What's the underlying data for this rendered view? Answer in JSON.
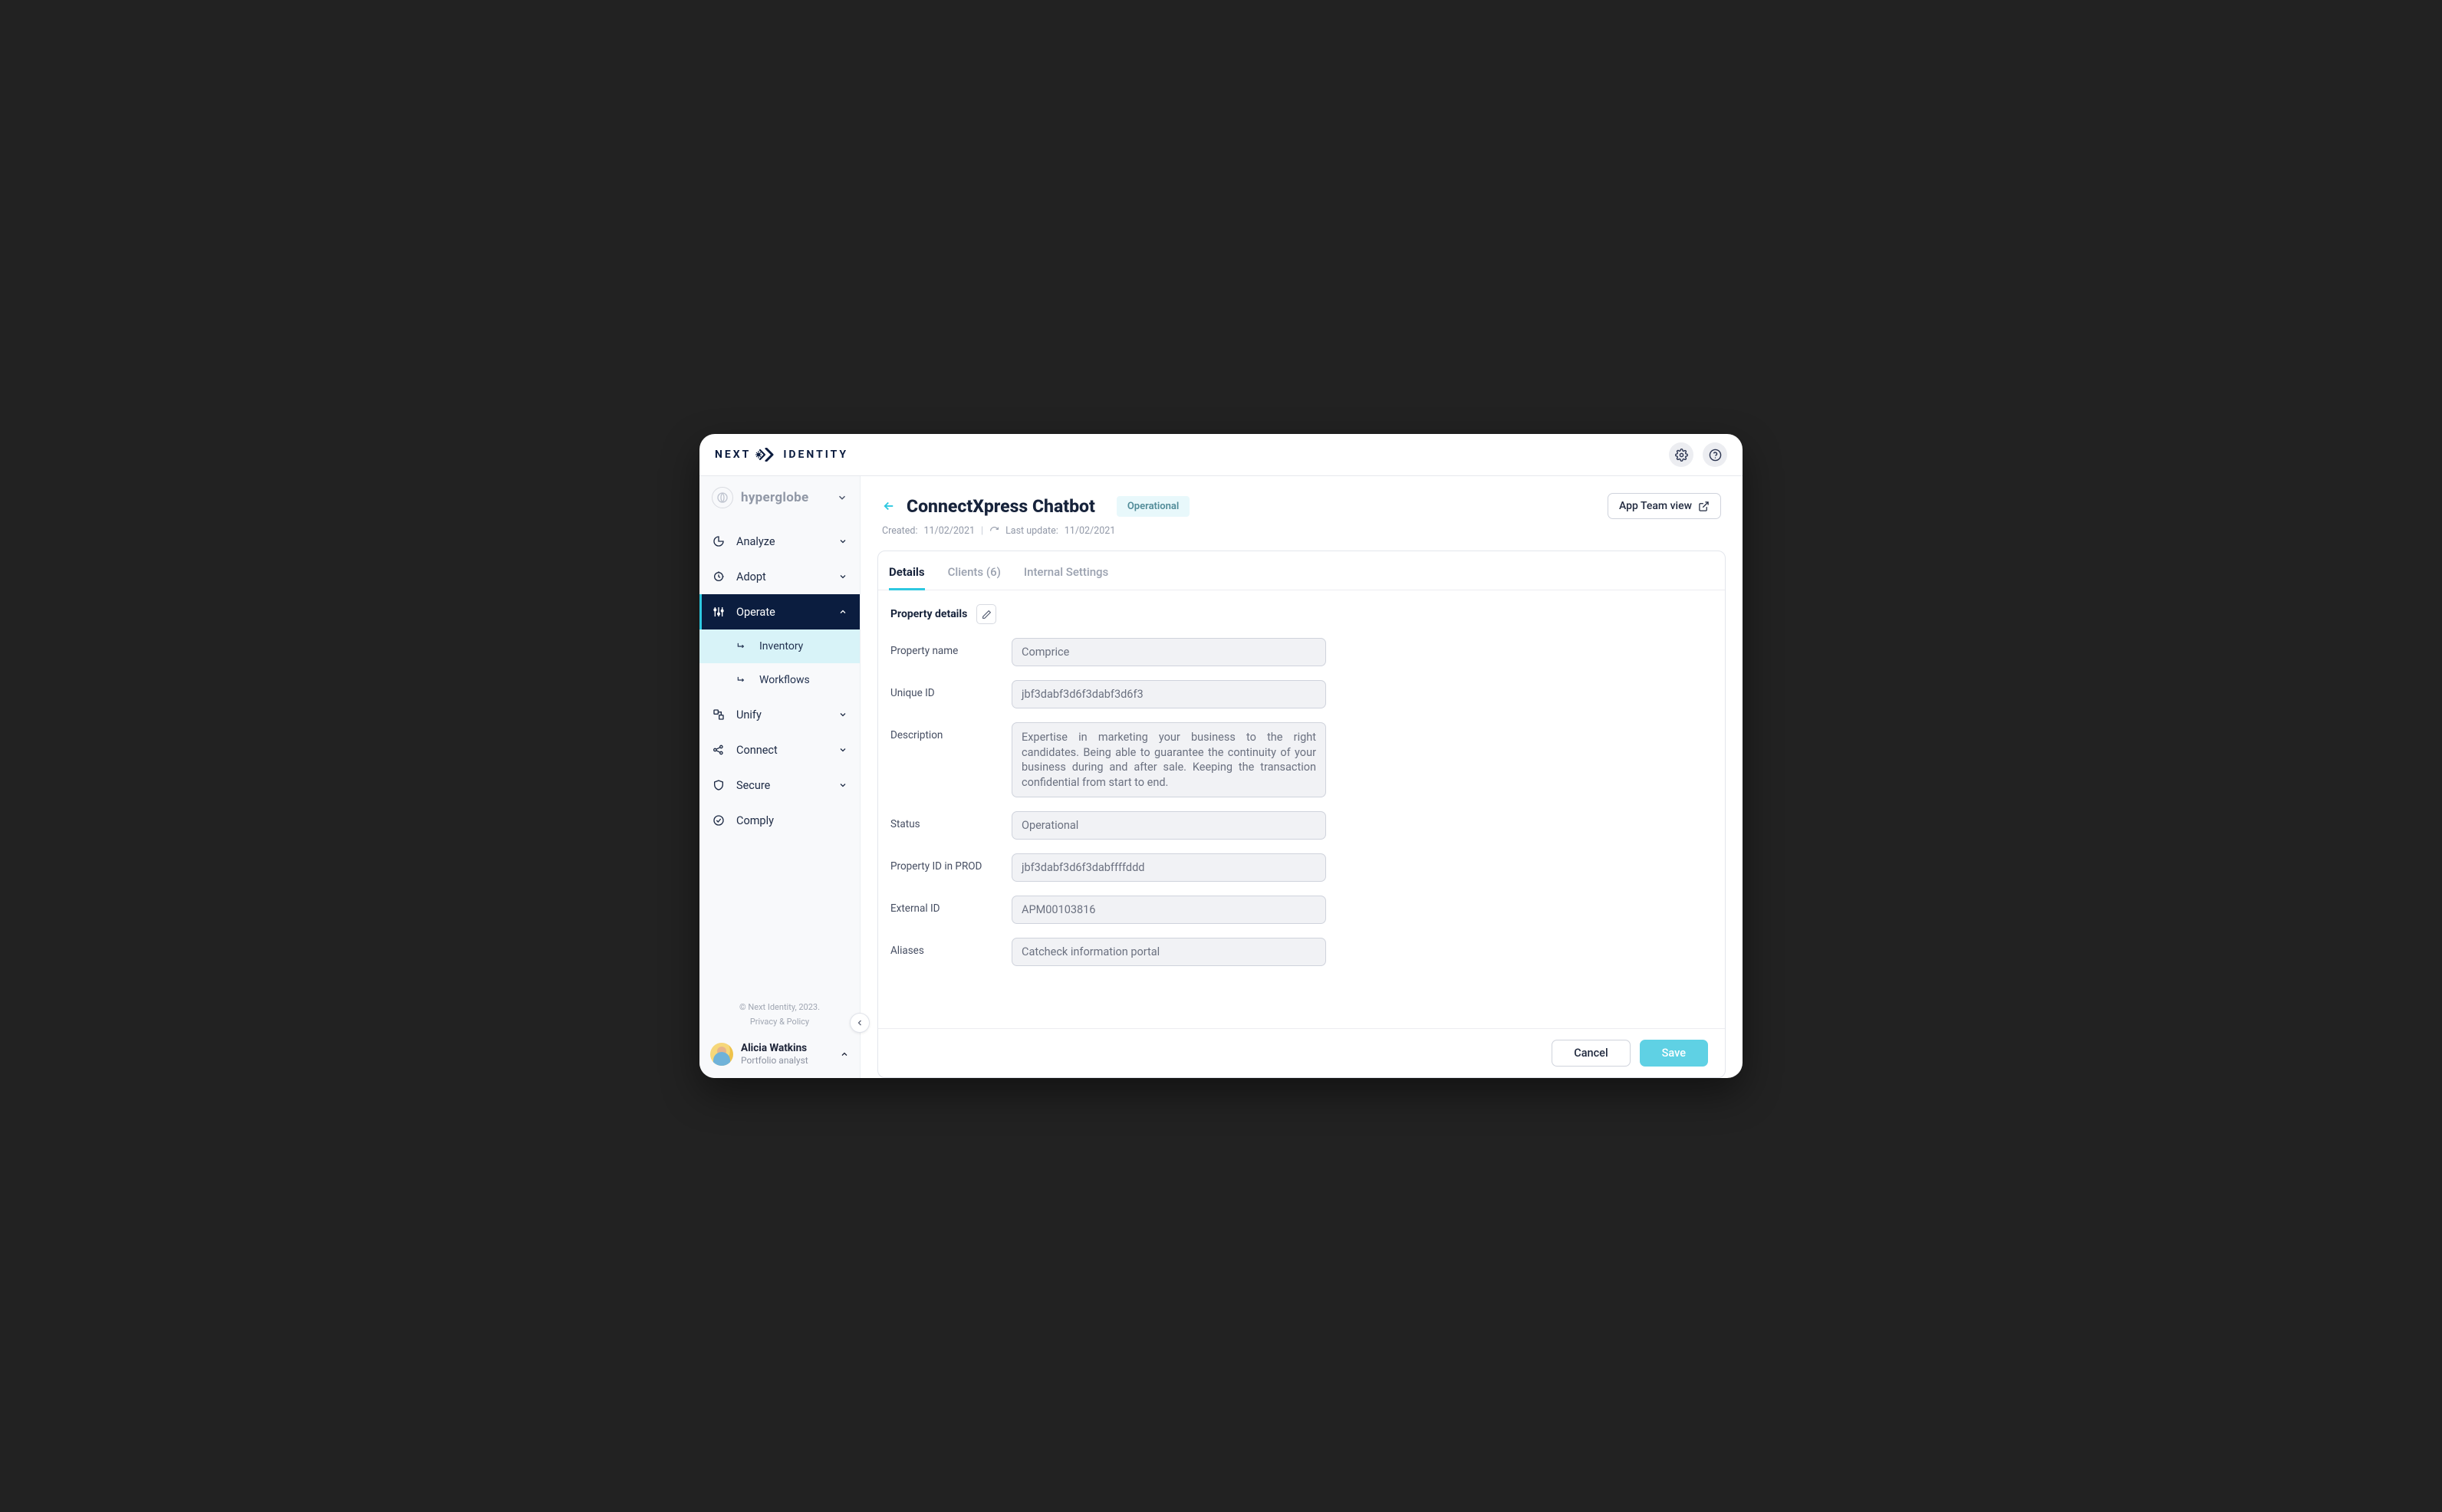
{
  "brand": {
    "left": "NEXT",
    "right": "IDENTITY"
  },
  "org": {
    "name": "hyperglobe"
  },
  "sidebar": {
    "items": [
      {
        "label": "Analyze"
      },
      {
        "label": "Adopt"
      },
      {
        "label": "Operate",
        "children": [
          {
            "label": "Inventory"
          },
          {
            "label": "Workflows"
          }
        ]
      },
      {
        "label": "Unify"
      },
      {
        "label": "Connect"
      },
      {
        "label": "Secure"
      },
      {
        "label": "Comply"
      }
    ]
  },
  "footer": {
    "copyright": "© Next Identity, 2023.",
    "privacy": "Privacy & Policy"
  },
  "user": {
    "name": "Alicia Watkins",
    "role": "Portfolio analyst"
  },
  "header": {
    "title": "ConnectXpress Chatbot",
    "status": "Operational",
    "app_team_view": "App Team view",
    "created_label": "Created:",
    "created_value": "11/02/2021",
    "updated_label": "Last update:",
    "updated_value": "11/02/2021"
  },
  "tabs": {
    "details": "Details",
    "clients": "Clients (6)",
    "internal": "Internal Settings"
  },
  "section_title": "Property details",
  "form": {
    "property_name": {
      "label": "Property name",
      "value": "Comprice"
    },
    "unique_id": {
      "label": "Unique ID",
      "value": "jbf3dabf3d6f3dabf3d6f3"
    },
    "description": {
      "label": "Description",
      "value": "Expertise in marketing your business to the right candidates. Being able to guarantee the continuity of your business during and after sale. Keeping the transaction confidential from start to end."
    },
    "status": {
      "label": "Status",
      "value": "Operational"
    },
    "prod_id": {
      "label": "Property ID in PROD",
      "value": "jbf3dabf3d6f3dabffffddd"
    },
    "external_id": {
      "label": "External ID",
      "value": "APM00103816"
    },
    "aliases": {
      "label": "Aliases",
      "value": "Catcheck information portal"
    }
  },
  "actions": {
    "cancel": "Cancel",
    "save": "Save"
  }
}
